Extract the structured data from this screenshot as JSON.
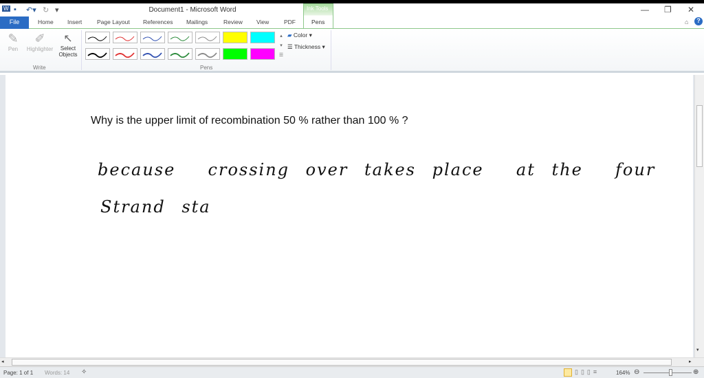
{
  "window": {
    "title": "Document1  -  Microsoft Word",
    "minimize": "—",
    "restore": "❐",
    "close": "✕"
  },
  "tabs": [
    "File",
    "Home",
    "Insert",
    "Page Layout",
    "References",
    "Mailings",
    "Review",
    "View",
    "PDF",
    "Pens"
  ],
  "contextual_tab": "Ink Tools",
  "ribbon": {
    "write_group": "Write",
    "pens_group": "Pens",
    "pen": "Pen",
    "highlighter": "Highlighter",
    "select_objects": "Select Objects",
    "color": "Color",
    "thickness": "Thickness",
    "pen_colors": [
      "#000000",
      "#e03030",
      "#3050b0",
      "#2a8a3a",
      "#888888",
      "#ffff00",
      "#00ffff"
    ],
    "pen_colors_row2": [
      "#000000",
      "#e03030",
      "#3050b0",
      "#2a8a3a",
      "#888888",
      "#00ff00",
      "#ff00ff"
    ]
  },
  "document": {
    "question": "Why is the upper limit of recombination 50 % rather than 100 % ?",
    "handwriting_line1": "because  crossing over takes place  at the  four",
    "handwriting_line2": "Strand sta"
  },
  "status": {
    "page": "Page: 1 of 1",
    "words": "Words: 14",
    "zoom": "164%"
  }
}
